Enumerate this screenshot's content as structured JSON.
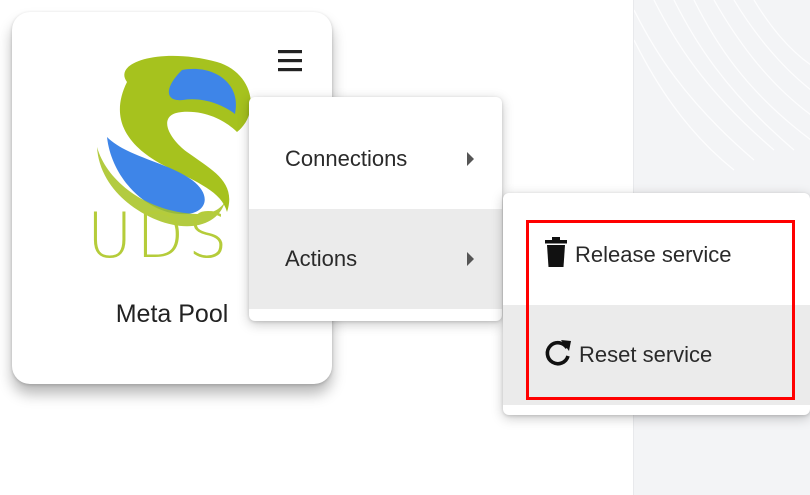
{
  "pool_card": {
    "title": "Meta Pool",
    "logo_text": "UDS",
    "menu_icon": "hamburger-icon"
  },
  "context_menu": {
    "items": [
      {
        "label": "Connections",
        "icon": "caret-right-icon"
      },
      {
        "label": "Actions",
        "icon": "caret-right-icon",
        "active": true
      }
    ]
  },
  "actions_submenu": {
    "items": [
      {
        "label": "Release service",
        "icon": "trash-icon"
      },
      {
        "label": "Reset service",
        "icon": "refresh-icon",
        "active": true
      }
    ]
  },
  "colors": {
    "highlight": "#ff0000",
    "logo_green": "#a6c21e",
    "logo_blue": "#3e85e8",
    "active_item": "#ebebeb"
  }
}
